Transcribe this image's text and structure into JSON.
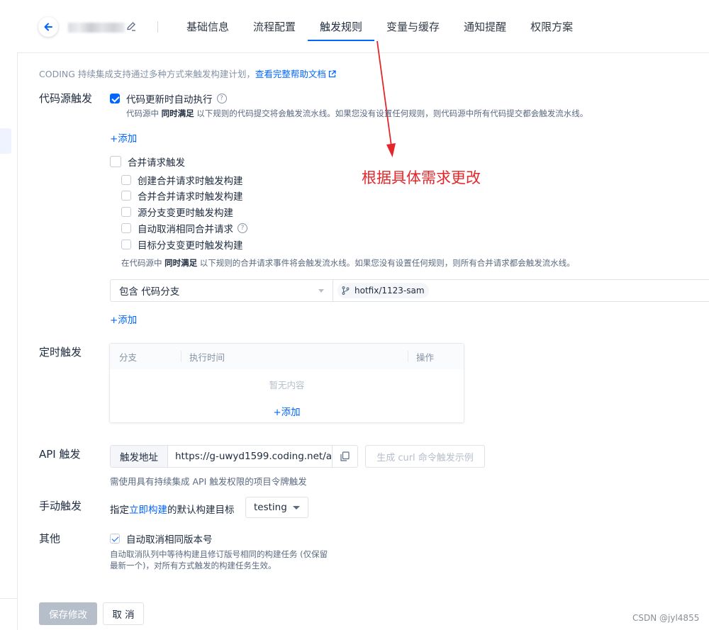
{
  "header": {
    "tabs": [
      "基础信息",
      "流程配置",
      "触发规则",
      "变量与缓存",
      "通知提醒",
      "权限方案"
    ],
    "active_tab": "触发规则"
  },
  "hint": {
    "text": "CODING 持续集成支持通过多种方式来触发构建计划，",
    "link": "查看完整帮助文档"
  },
  "annotation": "根据具体需求更改",
  "code_source": {
    "label": "代码源触发",
    "auto_exec_label": "代码更新时自动执行",
    "auto_exec_checked": true,
    "auto_exec_note_pre": "代码源中 ",
    "auto_exec_note_bold": "同时满足",
    "auto_exec_note_post": " 以下规则的代码提交将会触发流水线。如果您没有设置任何规则，则代码源中所有代码提交都会触发流水线。",
    "add_label": "+添加",
    "merge_label": "合并请求触发",
    "merge_checked": false,
    "merge_options": [
      {
        "label": "创建合并请求时触发构建",
        "checked": false
      },
      {
        "label": "合并合并请求时触发构建",
        "checked": false
      },
      {
        "label": "源分支变更时触发构建",
        "checked": false
      },
      {
        "label": "自动取消相同合并请求",
        "checked": false
      },
      {
        "label": "目标分支变更时触发构建",
        "checked": false
      }
    ],
    "merge_note_pre": "在代码源中 ",
    "merge_note_bold": "同时满足",
    "merge_note_post": " 以下规则的合并请求事件将会触发流水线。如果您没有设置任何规则，则所有合并请求都会触发流水线。",
    "filter_select": "包含 代码分支",
    "branch": "hotfix/1123-sam",
    "add_label_2": "+添加"
  },
  "schedule": {
    "label": "定时触发",
    "columns": [
      "分支",
      "执行时间",
      "操作"
    ],
    "empty": "暂无内容",
    "add_label": "+添加"
  },
  "api": {
    "label": "API 触发",
    "prefix": "触发地址",
    "url": "https://g-uwyd1599.coding.net/ap",
    "curl_button": "生成 curl 命令触发示例",
    "note": "需使用具有持续集成 API 触发权限的项目令牌触发"
  },
  "manual": {
    "label": "手动触发",
    "text_pre": "指定",
    "link": "立即构建",
    "text_post": "的默认构建目标",
    "select_value": "testing"
  },
  "other": {
    "label": "其他",
    "checkbox_label": "自动取消相同版本号",
    "checked": true,
    "note": "自动取消队列中等待构建且修订版号相同的构建任务 (仅保留最新一个)，对所有方式触发的构建任务生效。"
  },
  "footer": {
    "save": "保存修改",
    "cancel": "取 消"
  },
  "watermark": "CSDN @jyl4855"
}
